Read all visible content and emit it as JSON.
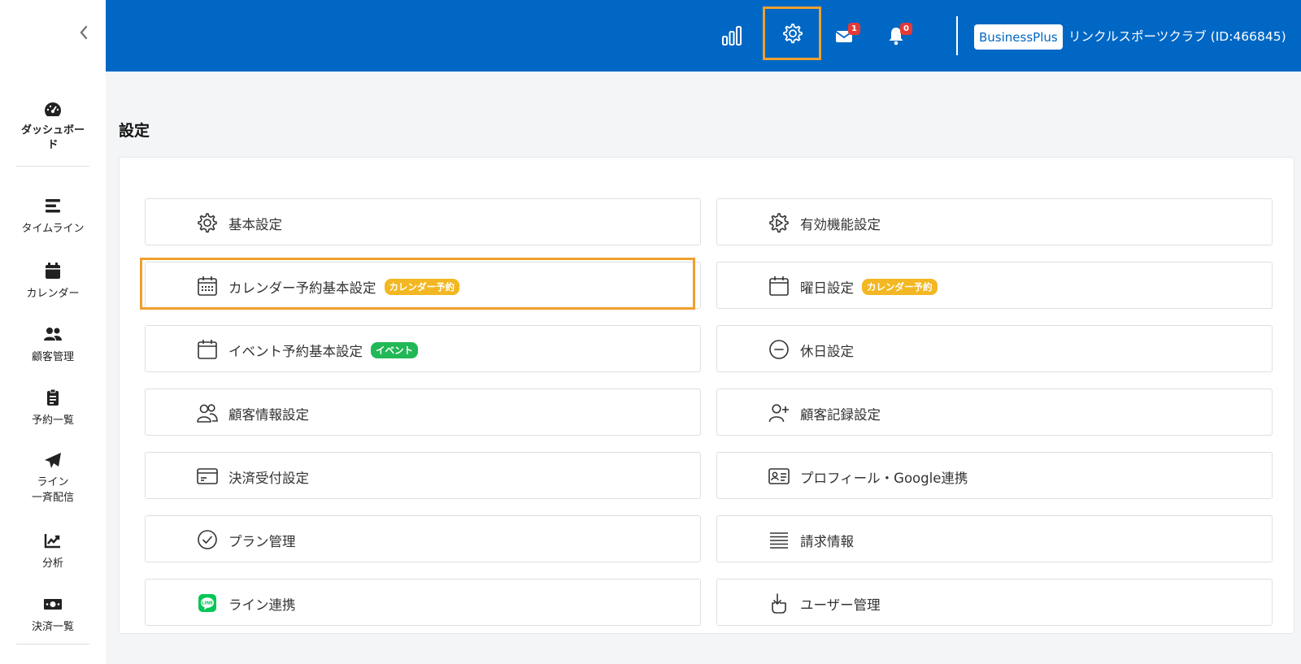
{
  "sidebar": {
    "items": [
      {
        "label": "ダッシュボード",
        "icon": "gauge-icon"
      },
      {
        "label": "タイムライン",
        "icon": "timeline-icon"
      },
      {
        "label": "カレンダー",
        "icon": "calendar-icon"
      },
      {
        "label": "顧客管理",
        "icon": "users-icon"
      },
      {
        "label": "予約一覧",
        "icon": "clipboard-icon"
      },
      {
        "label": "ライン\n一斉配信",
        "icon": "paper-plane-icon"
      },
      {
        "label": "分析",
        "icon": "chart-line-icon"
      },
      {
        "label": "決済一覧",
        "icon": "money-icon"
      }
    ]
  },
  "header": {
    "mail_count": "1",
    "notification_count": "0",
    "plan": "BusinessPlus",
    "org_name": "リンクルスポーツクラブ (ID:466845)",
    "bg_color": "#0067c5",
    "highlight_color": "#f0a02e"
  },
  "page": {
    "title": "設定"
  },
  "settings": {
    "left": [
      {
        "label": "基本設定",
        "icon": "gear-icon"
      },
      {
        "label": "カレンダー予約基本設定",
        "icon": "calendar-grid-icon",
        "tag": "カレンダー予約"
      },
      {
        "label": "イベント予約基本設定",
        "icon": "calendar-icon",
        "tag": "イベント"
      },
      {
        "label": "顧客情報設定",
        "icon": "users-outline-icon"
      },
      {
        "label": "決済受付設定",
        "icon": "credit-card-icon"
      },
      {
        "label": "プラン管理",
        "icon": "check-circle-icon"
      },
      {
        "label": "ライン連携",
        "icon": "line-logo-icon"
      }
    ],
    "right": [
      {
        "label": "有効機能設定",
        "icon": "feature-gear-icon"
      },
      {
        "label": "曜日設定",
        "icon": "calendar-icon",
        "tag": "カレンダー予約"
      },
      {
        "label": "休日設定",
        "icon": "minus-circle-icon"
      },
      {
        "label": "顧客記録設定",
        "icon": "user-plus-icon"
      },
      {
        "label": "プロフィール・Google連携",
        "icon": "id-card-icon"
      },
      {
        "label": "請求情報",
        "icon": "list-lines-icon"
      },
      {
        "label": "ユーザー管理",
        "icon": "hand-tap-icon"
      }
    ]
  }
}
